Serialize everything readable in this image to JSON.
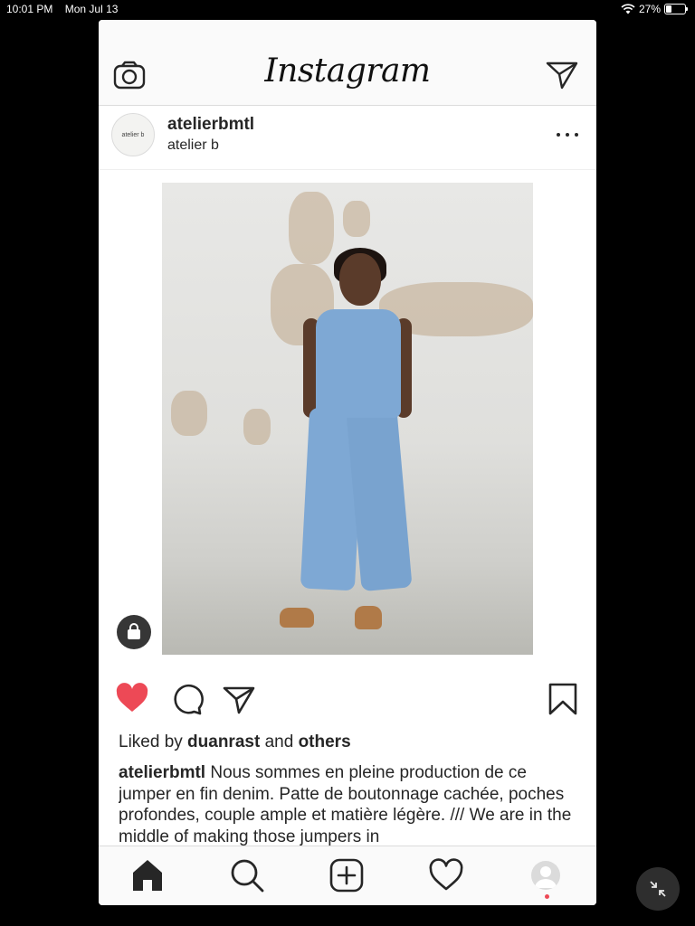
{
  "status_bar": {
    "time": "10:01 PM",
    "date": "Mon Jul 13",
    "battery_text": "27%",
    "icons": [
      "wifi-icon",
      "battery-icon"
    ]
  },
  "top_bar": {
    "logo": "Instagram",
    "icons": [
      "camera-icon",
      "direct-message-icon"
    ]
  },
  "post": {
    "avatar_text": "atelier b",
    "username": "atelierbmtl",
    "subname": "atelier b",
    "more_icon": "more-options-icon",
    "shop_badge_icon": "shopping-bag-icon",
    "liked_prefix": "Liked by ",
    "liked_user": "duanrast",
    "liked_and": " and ",
    "liked_others": "others",
    "caption_user": "atelierbmtl",
    "caption_text": " Nous sommes en pleine production de ce jumper en fin denim. Patte de boutonnage cachée, poches profondes, couple ample et matière légère. /// We are in the middle of making those jumpers in",
    "liked": true,
    "accent_color": "#ed4956"
  },
  "actions": {
    "icons": [
      "heart-icon",
      "comment-icon",
      "share-icon",
      "bookmark-icon"
    ]
  },
  "tab_bar": {
    "icons": [
      "home-icon",
      "search-icon",
      "add-post-icon",
      "activity-heart-icon",
      "profile-icon"
    ]
  },
  "floating_button": {
    "icon": "collapse-arrows-icon"
  }
}
